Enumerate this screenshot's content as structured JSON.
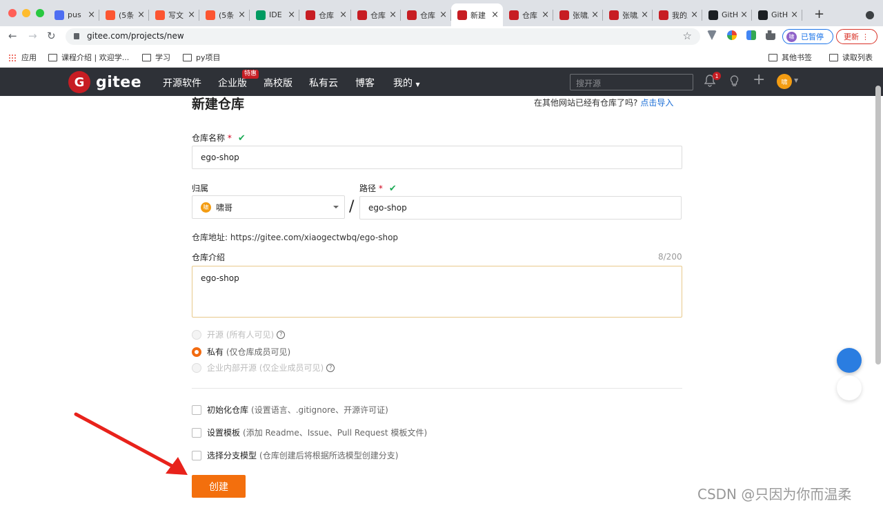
{
  "browser": {
    "tabs": [
      {
        "title": "pus",
        "icon": "baidu-paw-icon",
        "color": "#4e6ef2"
      },
      {
        "title": "(5条",
        "icon": "csdn-icon",
        "color": "#fc5531"
      },
      {
        "title": "写文",
        "icon": "csdn-icon",
        "color": "#fc5531"
      },
      {
        "title": "(5条",
        "icon": "csdn-icon",
        "color": "#fc5531"
      },
      {
        "title": "IDE",
        "icon": "segmentfault-icon",
        "color": "#009a61"
      },
      {
        "title": "仓库",
        "icon": "gitee-icon",
        "color": "#c71d23"
      },
      {
        "title": "仓库",
        "icon": "gitee-icon",
        "color": "#c71d23"
      },
      {
        "title": "仓库",
        "icon": "gitee-icon",
        "color": "#c71d23"
      },
      {
        "title": "新建",
        "icon": "gitee-icon",
        "color": "#c71d23",
        "active": true
      },
      {
        "title": "仓库 - §",
        "icon": "gitee-icon",
        "color": "#c71d23"
      },
      {
        "title": "张啸/eg",
        "icon": "gitee-icon",
        "color": "#c71d23"
      },
      {
        "title": "张啸/eg",
        "icon": "gitee-icon",
        "color": "#c71d23"
      },
      {
        "title": "我的工作",
        "icon": "gitee-icon",
        "color": "#c71d23"
      },
      {
        "title": "GitHub",
        "icon": "github-icon",
        "color": "#1b1f23"
      },
      {
        "title": "GitHub",
        "icon": "github-icon",
        "color": "#1b1f23"
      }
    ],
    "url": "gitee.com/projects/new",
    "profile_status": "已暂停",
    "profile_initial": "啸",
    "update_label": "更新",
    "bookmarks": {
      "apps": "应用",
      "course": "课程介绍 | 欢迎学...",
      "study": "学习",
      "py": "py项目",
      "other": "其他书签",
      "reading": "读取列表"
    }
  },
  "gitee": {
    "logo_letter": "G",
    "logo_text": "gitee",
    "nav": [
      "开源软件",
      "企业版",
      "高校版",
      "私有云",
      "博客",
      "我的"
    ],
    "hot_badge": "特惠",
    "search_placeholder": "搜开源",
    "notif_count": "1",
    "user_initial": "啸"
  },
  "form": {
    "title": "新建仓库",
    "import_prompt": "在其他网站已经有仓库了吗?",
    "import_link": "点击导入",
    "name_label": "仓库名称",
    "required_mark": "*",
    "name_value": "ego-shop",
    "owner_label": "归属",
    "owner_value": "啸哥",
    "owner_initial": "啸",
    "path_label": "路径",
    "path_value": "ego-shop",
    "slash": "/",
    "address_label": "仓库地址:",
    "address_value": "https://gitee.com/xiaogectwbq/ego-shop",
    "desc_label": "仓库介绍",
    "desc_count": "8/200",
    "desc_value": "ego-shop",
    "visibility": [
      {
        "label": "开源",
        "hint": "(所有人可见)",
        "state": "disabled",
        "help": true
      },
      {
        "label": "私有",
        "hint": "(仅仓库成员可见)",
        "state": "checked",
        "help": false
      },
      {
        "label": "企业内部开源",
        "hint": "(仅企业成员可见)",
        "state": "disabled",
        "help": true
      }
    ],
    "options": [
      {
        "label": "初始化仓库",
        "hint": "(设置语言、.gitignore、开源许可证)"
      },
      {
        "label": "设置模板",
        "hint": "(添加 Readme、Issue、Pull Request 模板文件)"
      },
      {
        "label": "选择分支模型",
        "hint": "(仓库创建后将根据所选模型创建分支)"
      }
    ],
    "create_label": "创建"
  },
  "watermark": "CSDN @只因为你而温柔"
}
